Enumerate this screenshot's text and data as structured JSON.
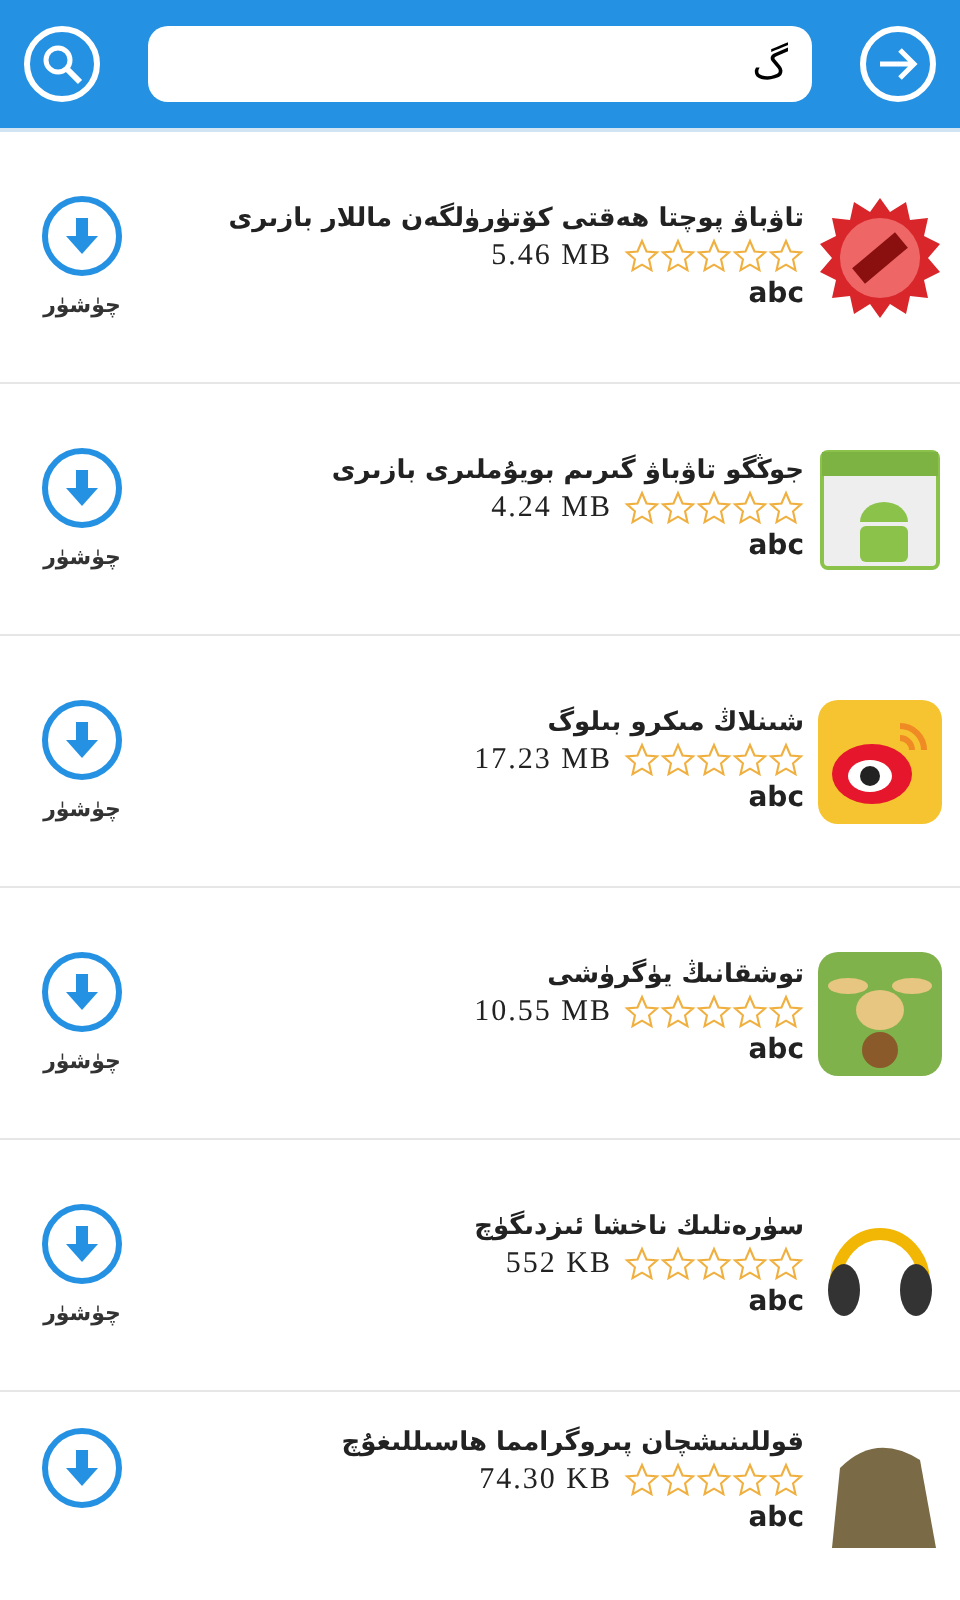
{
  "search": {
    "value": "گ"
  },
  "apps": [
    {
      "title": "تاۋباۋ پوچتا ھەقتى كۆتۈرۈلگەن ماللار بازىرى",
      "size": "5.46 MB",
      "stars": 0,
      "note": "abc",
      "action": "چۈشۈر"
    },
    {
      "title": "جوڭگو تاۋباۋ گىرىم بويۇملىرى بازىرى",
      "size": "4.24 MB",
      "stars": 0,
      "note": "abc",
      "action": "چۈشۈر"
    },
    {
      "title": "شىنلاڭ مىكرو بىلوگ",
      "size": "17.23 MB",
      "stars": 0,
      "note": "abc",
      "action": "چۈشۈر"
    },
    {
      "title": "توشقانىڭ يۈگرۈشى",
      "size": "10.55 MB",
      "stars": 0,
      "note": "abc",
      "action": "چۈشۈر"
    },
    {
      "title": "سۈرەتلىك ناخشا ئىزدىگۈچ",
      "size": "552 KB",
      "stars": 0,
      "note": "abc",
      "action": "چۈشۈر"
    },
    {
      "title": "قوللىنىشچان پىروگرامما ھاسىللىغۇچ",
      "size": "74.30 KB",
      "stars": 0,
      "note": "abc"
    }
  ]
}
